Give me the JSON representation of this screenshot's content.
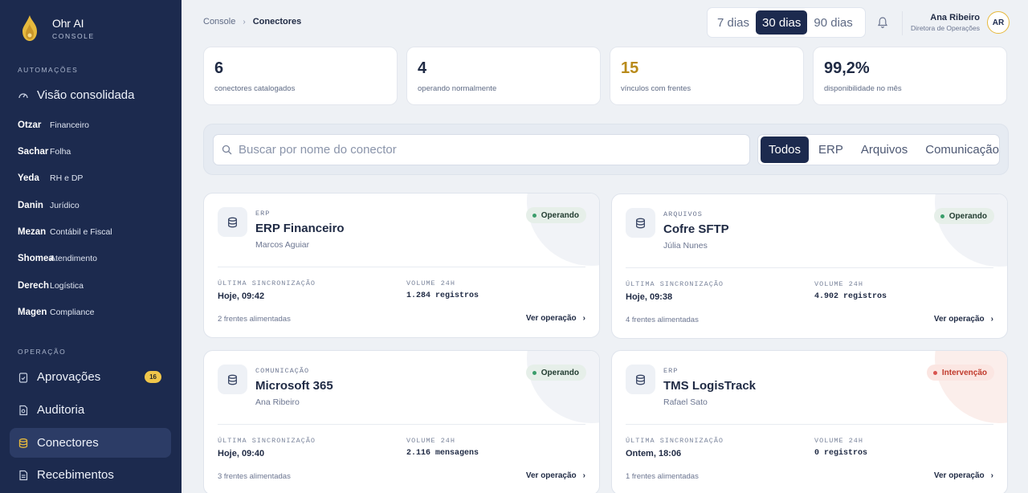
{
  "brand": {
    "name": "Ohr",
    "name_suffix": "AI",
    "subtitle": "CONSOLE",
    "accent": "#e6b93d"
  },
  "sidebar": {
    "section_automations": "AUTOMAÇÕES",
    "overview": "Visão consolidada",
    "units": [
      {
        "code": "Otzar",
        "name": "Financeiro"
      },
      {
        "code": "Sachar",
        "name": "Folha"
      },
      {
        "code": "Yeda",
        "name": "RH e DP"
      },
      {
        "code": "Danin",
        "name": "Jurídico"
      },
      {
        "code": "Mezan",
        "name": "Contábil e Fiscal"
      },
      {
        "code": "Shomea",
        "name": "Atendimento"
      },
      {
        "code": "Derech",
        "name": "Logística"
      },
      {
        "code": "Magen",
        "name": "Compliance"
      }
    ],
    "section_operation": "OPERAÇÃO",
    "approvals": "Aprovações",
    "approvals_badge": "16",
    "audit": "Auditoria",
    "connectors": "Conectores",
    "receipts": "Recebimentos"
  },
  "topbar": {
    "breadcrumb_root": "Console",
    "breadcrumb_current": "Conectores",
    "ranges": [
      "7 dias",
      "30 dias",
      "90 dias"
    ],
    "active_range": "30 dias",
    "user_name": "Ana Ribeiro",
    "user_role": "Diretora de Operações",
    "user_initials": "AR"
  },
  "stats": [
    {
      "value": "6",
      "label": "conectores catalogados"
    },
    {
      "value": "4",
      "label": "operando normalmente"
    },
    {
      "value": "15",
      "label": "vínculos com frentes"
    },
    {
      "value": "99,2%",
      "label": "disponibilidade no mês"
    }
  ],
  "filters": {
    "search_placeholder": "Buscar por nome do conector",
    "search_value": "",
    "categories": [
      "Todos",
      "ERP",
      "Arquivos",
      "Comunicação"
    ],
    "active_category": "Todos"
  },
  "card_labels": {
    "last_sync": "ÚLTIMA SINCRONIZAÇÃO",
    "volume": "VOLUME 24H",
    "action": "Ver operação"
  },
  "connectors": [
    {
      "category": "ERP",
      "title": "ERP Financeiro",
      "owner": "Marcos Aguiar",
      "status": "Operando",
      "last_sync": "Hoje, 09:42",
      "volume": "1.284 registros",
      "fronts": "2 frentes alimentadas"
    },
    {
      "category": "ARQUIVOS",
      "title": "Cofre SFTP",
      "owner": "Júlia Nunes",
      "status": "Operando",
      "last_sync": "Hoje, 09:38",
      "volume": "4.902 registros",
      "fronts": "4 frentes alimentadas"
    },
    {
      "category": "COMUNICAÇÃO",
      "title": "Microsoft 365",
      "owner": "Ana Ribeiro",
      "status": "Operando",
      "last_sync": "Hoje, 09:40",
      "volume": "2.116 mensagens",
      "fronts": "3 frentes alimentadas"
    },
    {
      "category": "ERP",
      "title": "TMS LogisTrack",
      "owner": "Rafael Sato",
      "status": "Intervenção",
      "last_sync": "Ontem, 18:06",
      "volume": "0 registros",
      "fronts": "1 frentes alimentadas"
    }
  ]
}
